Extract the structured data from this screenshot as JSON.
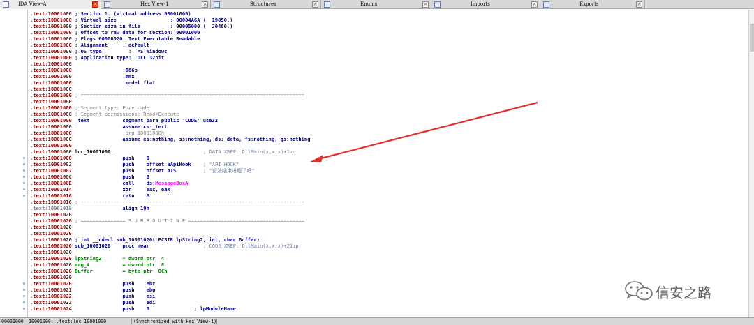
{
  "tabs": [
    {
      "label": "IDA View-A",
      "active": true,
      "icon": "ida-view-icon"
    },
    {
      "label": "Hex View-1",
      "active": false,
      "icon": "hex-view-icon"
    },
    {
      "label": "Structures",
      "active": false,
      "icon": "structures-icon"
    },
    {
      "label": "Enums",
      "active": false,
      "icon": "enums-icon"
    },
    {
      "label": "Imports",
      "active": false,
      "icon": "imports-icon"
    },
    {
      "label": "Exports",
      "active": false,
      "icon": "exports-icon"
    }
  ],
  "listing": {
    "lines": [
      {
        "addr": ".text:10001000",
        "text": "; Section 1. (virtual address 00001000)",
        "cls": "cm"
      },
      {
        "addr": ".text:10001000",
        "text": "; Virtual size                  : 00004A6A (  19050.)",
        "cls": "cm"
      },
      {
        "addr": ".text:10001000",
        "text": "; Section size in file          : 00005000 (  20480.)",
        "cls": "cm"
      },
      {
        "addr": ".text:10001000",
        "text": "; Offset to raw data for section: 00001000",
        "cls": "cm"
      },
      {
        "addr": ".text:10001000",
        "text": "; Flags 60000020: Text Executable Readable",
        "cls": "cm"
      },
      {
        "addr": ".text:10001000",
        "text": "; Alignment     : default",
        "cls": "cm"
      },
      {
        "addr": ".text:10001000",
        "text": "; OS type         :  MS Windows",
        "cls": "cm"
      },
      {
        "addr": ".text:10001000",
        "text": "; Application type:  DLL 32bit",
        "cls": "cm"
      },
      {
        "addr": ".text:10001000",
        "text": "",
        "cls": "cm"
      },
      {
        "addr": ".text:10001000",
        "text": "                .686p",
        "cls": "ins"
      },
      {
        "addr": ".text:10001000",
        "text": "                .mmx",
        "cls": "ins"
      },
      {
        "addr": ".text:10001000",
        "text": "                .model flat",
        "cls": "ins"
      },
      {
        "addr": ".text:10001000",
        "text": "",
        "cls": "cm"
      },
      {
        "addr": ".text:10001000",
        "text": "; ===========================================================================",
        "cls": "cmg"
      },
      {
        "addr": ".text:10001000",
        "text": "",
        "cls": "cm"
      },
      {
        "addr": ".text:10001000",
        "text": "; Segment type: Pure code",
        "cls": "cmg"
      },
      {
        "addr": ".text:10001000",
        "text": "; Segment permissions: Read/Execute",
        "cls": "cmg"
      },
      {
        "addr": ".text:10001000",
        "text": "_text           segment para public 'CODE' use32",
        "cls": "ins"
      },
      {
        "addr": ".text:10001000",
        "text": "                assume cs:_text",
        "cls": "ins"
      },
      {
        "addr": ".text:10001000",
        "text": "                ;org 10001000h",
        "cls": "cmg"
      },
      {
        "addr": ".text:10001000",
        "text": "                assume es:nothing, ss:nothing, ds:_data, fs:nothing, gs:nothing",
        "cls": "ins"
      },
      {
        "addr": ".text:10001000",
        "text": "",
        "cls": "cm"
      },
      {
        "addr": ".text:10001000",
        "text": "loc_10001000:",
        "cls": "blk",
        "xref": "; DATA XREF: DllMain(x,x,x)+1↓o"
      },
      {
        "addr": ".text:10001000",
        "text": "                push    0",
        "cls": "ins"
      },
      {
        "addr": ".text:10001002",
        "text": "                push    offset aApiHook",
        "cls": "ins",
        "xref": "; \"API HOOK\""
      },
      {
        "addr": ".text:10001007",
        "text": "                push    offset aIS",
        "cls": "ins",
        "xref": "; \"设法结束进程了吧\""
      },
      {
        "addr": ".text:1000100C",
        "text": "                push    0",
        "cls": "ins"
      },
      {
        "addr": ".text:1000100E",
        "text": "                call    ds:",
        "cls": "ins",
        "pink": "MessageBoxA"
      },
      {
        "addr": ".text:10001014",
        "text": "                xor     eax, eax",
        "cls": "ins"
      },
      {
        "addr": ".text:10001016",
        "text": "                retn    8",
        "cls": "ins"
      },
      {
        "addr": ".text:10001016",
        "text": "; ---------------------------------------------------------------------------",
        "cls": "cmg"
      },
      {
        "addr": ".text:10001019",
        "text": "                align 10h",
        "cls": "ins",
        "gray": true
      },
      {
        "addr": ".text:10001020",
        "text": "",
        "cls": "cm"
      },
      {
        "addr": ".text:10001020",
        "text": "; =============== S U B R O U T I N E =======================================",
        "cls": "cmg"
      },
      {
        "addr": ".text:10001020",
        "text": "",
        "cls": "cm"
      },
      {
        "addr": ".text:10001020",
        "text": "",
        "cls": "cm"
      },
      {
        "addr": ".text:10001020",
        "text": "; int __cdecl sub_10001020(LPCSTR lpString2, int, char Buffer)",
        "cls": "cm"
      },
      {
        "addr": ".text:10001020",
        "text": "sub_10001020    proc near",
        "cls": "ins",
        "xref": "; CODE XREF: DllMain(x,x,x)+21↓p"
      },
      {
        "addr": ".text:10001020",
        "text": "",
        "cls": "cm"
      },
      {
        "addr": ".text:10001020",
        "text": "lpString2       = dword ptr  4",
        "cls": "grn"
      },
      {
        "addr": ".text:10001020",
        "text": "arg_4           = dword ptr  8",
        "cls": "grn"
      },
      {
        "addr": ".text:10001020",
        "text": "Buffer          = byte ptr  0Ch",
        "cls": "grn"
      },
      {
        "addr": ".text:10001020",
        "text": "",
        "cls": "cm"
      },
      {
        "addr": ".text:10001020",
        "text": "                push    ebx",
        "cls": "ins"
      },
      {
        "addr": ".text:10001021",
        "text": "                push    ebp",
        "cls": "ins"
      },
      {
        "addr": ".text:10001022",
        "text": "                push    esi",
        "cls": "ins"
      },
      {
        "addr": ".text:10001023",
        "text": "                push    edi",
        "cls": "ins"
      },
      {
        "addr": ".text:10001024",
        "text": "                push    0               ; lpModuleName",
        "cls": "ins"
      }
    ]
  },
  "status": {
    "offset": "00001000",
    "location": "10001000: .text:loc_10001000",
    "sync": "(Synchronized with Hex View-1)"
  },
  "watermark": {
    "text": "信安之路"
  },
  "colors": {
    "address": "#8b0000",
    "comment": "#000080",
    "stack_var": "#008000",
    "import": "#ff00ff",
    "arrow": "#e03030"
  }
}
